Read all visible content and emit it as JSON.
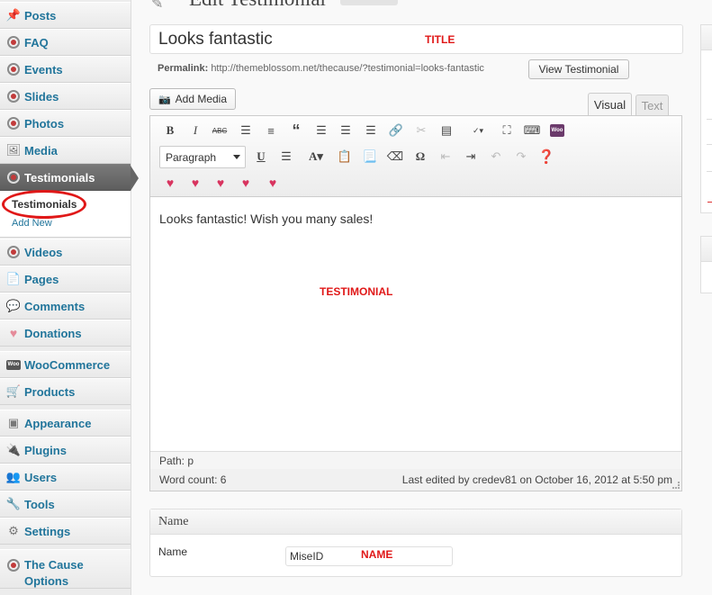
{
  "sidebar": {
    "items": [
      {
        "label": "Posts",
        "icon": "pushpin-icon"
      },
      {
        "label": "FAQ",
        "icon": "wp-plugin-icon"
      },
      {
        "label": "Events",
        "icon": "wp-plugin-icon"
      },
      {
        "label": "Slides",
        "icon": "wp-plugin-icon"
      },
      {
        "label": "Photos",
        "icon": "wp-plugin-icon"
      },
      {
        "label": "Media",
        "icon": "media-icon"
      },
      {
        "label": "Testimonials",
        "icon": "wp-plugin-icon"
      },
      {
        "label": "Videos",
        "icon": "wp-plugin-icon"
      },
      {
        "label": "Pages",
        "icon": "pages-icon"
      },
      {
        "label": "Comments",
        "icon": "comment-bubble-icon"
      },
      {
        "label": "Donations",
        "icon": "heart-icon"
      },
      {
        "label": "WooCommerce",
        "icon": "woo-icon"
      },
      {
        "label": "Products",
        "icon": "cart-icon"
      },
      {
        "label": "Appearance",
        "icon": "appearance-icon"
      },
      {
        "label": "Plugins",
        "icon": "plug-icon"
      },
      {
        "label": "Users",
        "icon": "users-icon"
      },
      {
        "label": "Tools",
        "icon": "tools-icon"
      },
      {
        "label": "Settings",
        "icon": "settings-icon"
      },
      {
        "label": "The Cause Options",
        "icon": "wp-plugin-icon"
      }
    ],
    "submenu": {
      "current": "Testimonials",
      "add_new": "Add New"
    }
  },
  "page": {
    "heading": "Edit Testimonial",
    "title_value": "Looks fantastic",
    "title_annotation": "TITLE",
    "permalink_label": "Permalink:",
    "permalink_url": "http://themeblossom.net/thecause/?testimonial=looks-fantastic",
    "view_button": "View Testimonial",
    "add_media": "Add Media",
    "tab_visual": "Visual",
    "tab_text": "Text"
  },
  "editor": {
    "format_select": "Paragraph",
    "content": "Looks fantastic! Wish you many sales!",
    "content_annotation": "TESTIMONIAL",
    "path": "Path: p",
    "word_count": "Word count: 6",
    "last_edited": "Last edited by credev81 on October 16, 2012 at 5:50 pm",
    "toolbar_row1": [
      "bold-icon",
      "italic-icon",
      "strikethrough-icon",
      "bullet-list-icon",
      "numbered-list-icon",
      "blockquote-icon",
      "align-left-icon",
      "align-center-icon",
      "align-right-icon",
      "link-icon",
      "unlink-icon",
      "more-tag-icon",
      "spellcheck-icon",
      "fullscreen-icon",
      "kitchen-sink-icon",
      "woo-shortcode-icon"
    ],
    "toolbar_row2": [
      "underline-icon",
      "justify-icon",
      "text-color-icon",
      "paste-text-icon",
      "paste-word-icon",
      "clear-formatting-icon",
      "special-char-icon",
      "outdent-icon",
      "indent-icon",
      "undo-icon",
      "redo-icon",
      "help-icon"
    ],
    "toolbar_row3": [
      "shortcode-heart-add-icon",
      "shortcode-heart-arrow-icon",
      "shortcode-heart-broken-icon",
      "shortcode-heart-percent-icon",
      "shortcode-heart-user-icon"
    ]
  },
  "name_box": {
    "heading": "Name",
    "label": "Name",
    "value": "MiseID",
    "annotation": "NAME"
  },
  "colors": {
    "annotation_red": "#e01818",
    "link_blue": "#21759b",
    "active_menu": "#6a6a6a"
  }
}
